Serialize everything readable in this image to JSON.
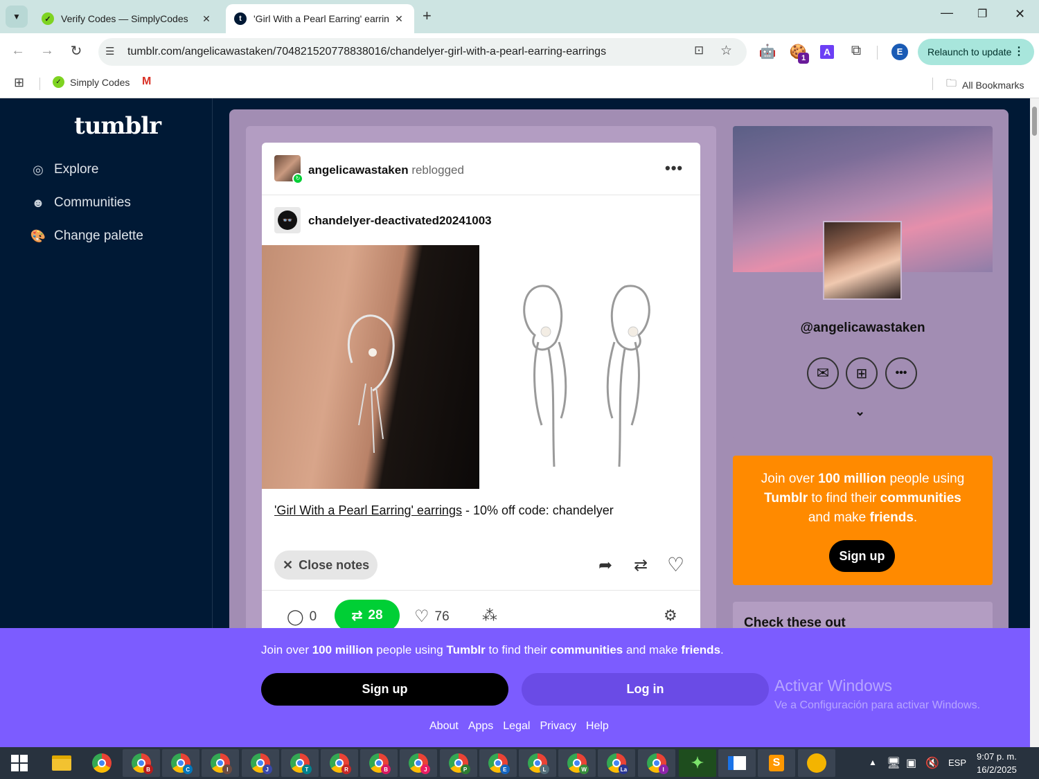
{
  "browser": {
    "tabs": [
      {
        "title": "Verify Codes — SimplyCodes",
        "active": false
      },
      {
        "title": "'Girl With a Pearl Earring' earrin",
        "active": true
      }
    ],
    "url": "tumblr.com/angelicawastaken/704821520778838016/chandelyer-girl-with-a-pearl-earring-earrings",
    "relaunch_label": "Relaunch to update",
    "profile_initial": "E",
    "extension_badge": "1",
    "bookmarks": [
      {
        "label": "Simply Codes"
      },
      {
        "label": ""
      }
    ],
    "all_bookmarks_label": "All Bookmarks"
  },
  "tumblr": {
    "logo": "tumblr",
    "nav": [
      {
        "label": "Explore",
        "icon": "compass-icon"
      },
      {
        "label": "Communities",
        "icon": "people-icon"
      },
      {
        "label": "Change palette",
        "icon": "palette-icon"
      }
    ],
    "post": {
      "reblogger": "angelicawastaken",
      "reblogged_word": "reblogged",
      "original_author": "chandelyer-deactivated20241003",
      "link_text": "'Girl With a Pearl Earring' earrings",
      "caption_rest": " - 10% off code: chandelyer",
      "close_notes_label": "Close notes",
      "counts": {
        "comments": "0",
        "reblogs": "28",
        "likes": "76"
      }
    },
    "profile": {
      "handle": "@angelicawastaken"
    },
    "promo": {
      "line1a": "Join over ",
      "line1b": "100 million",
      "line1c": " people using",
      "line2a": "Tumblr",
      "line2b": " to find their ",
      "line2c": "communities",
      "line3a": "and make ",
      "line3b": "friends",
      "line3c": ".",
      "signup_label": "Sign up"
    },
    "check_title": "Check these out",
    "banner": {
      "t1": "Join over ",
      "t2": "100 million",
      "t3": " people using ",
      "t4": "Tumblr",
      "t5": " to find their ",
      "t6": "communities",
      "t7": " and make ",
      "t8": "friends",
      "t9": ".",
      "signup_label": "Sign up",
      "login_label": "Log in",
      "footer_links": [
        "About",
        "Apps",
        "Legal",
        "Privacy",
        "Help"
      ]
    },
    "watermark": {
      "title": "Activar Windows",
      "sub": "Ve a Configuración para activar Windows."
    }
  },
  "taskbar": {
    "chrome_badges": [
      "B",
      "C",
      "I",
      "J",
      "T",
      "R",
      "B",
      "J",
      "P",
      "E",
      "L",
      "W",
      "La",
      "I"
    ],
    "lang": "ESP",
    "time": "9:07 p. m.",
    "date": "16/2/2025"
  }
}
